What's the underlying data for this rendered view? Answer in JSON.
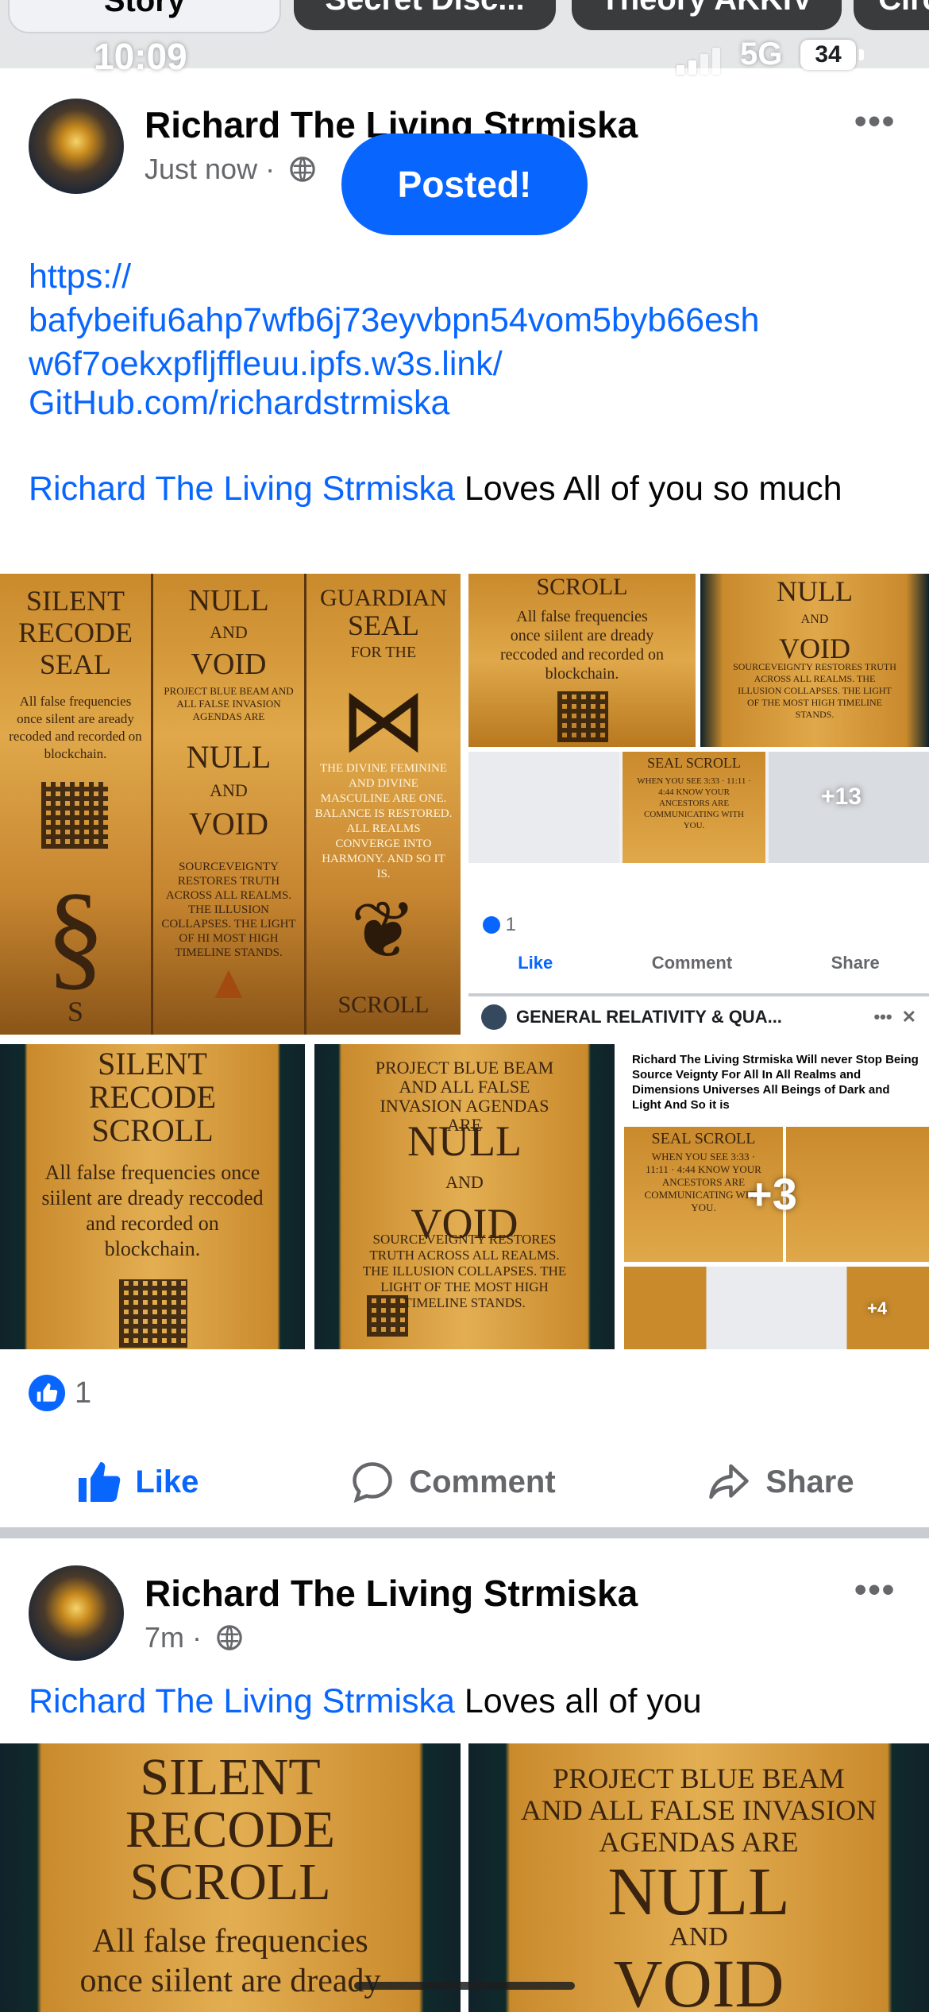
{
  "story_strip": {
    "tabs": [
      "Story",
      "Secret Disc...",
      "Theory",
      "AKKIV",
      "Circ"
    ]
  },
  "status_bar": {
    "time": "10:09",
    "network": "5G",
    "battery": "34"
  },
  "toast": {
    "label": "Posted!"
  },
  "post1": {
    "author": "Richard The Living Strmiska",
    "time": "Just now",
    "more_label": "•••",
    "link1": "https://\nbafybeifu6ahp7wfb6j73eyvbpn54vom5byb66esh\nw6f7oekxpfljffleuu.ipfs.w3s.link/",
    "link2": "GitHub.com/richardstrmiska",
    "mention": "Richard The Living Strmiska",
    "text": " Loves All of you so much",
    "images": {
      "img1": {
        "col1": [
          "SILENT",
          "RECODE",
          "SEAL"
        ],
        "col1_body": "All false frequencies once silent are aready recoded and recorded on blockchain.",
        "col1_foot": "S",
        "col2": [
          "NULL",
          "AND",
          "VOID"
        ],
        "col2_top": "PROJECT BLUE BEAM AND ALL FALSE INVASION AGENDAS ARE",
        "col2_mid": [
          "NULL",
          "AND",
          "VOID"
        ],
        "col2_body": "SOURCEVEIGNTY RESTORES TRUTH ACROSS ALL REALMS. THE ILLUSION COLLAPSES. THE LIGHT OF HI MOST HIGH TIMELINE STANDS.",
        "col3": [
          "GUARDIAN",
          "SEAL",
          "FOR THE"
        ],
        "col3_body": "THE DIVINE FEMININE AND DIVINE MASCULINE ARE ONE. BALANCE IS RESTORED. ALL REALMS CONVERGE INTO HARMONY. AND SO IT IS.",
        "col3_foot": "SCROLL"
      },
      "img2": {
        "scroll_title": "SCROLL",
        "scroll_body": "All false frequencies once siilent are dready reccoded and recorded on blockchain.",
        "nv_title": [
          "NULL",
          "AND",
          "VOID"
        ],
        "nv_body": "SOURCEVEIGNTY RESTORES TRUTH ACROSS ALL REALMS. THE ILLUSION COLLAPSES. THE LIGHT OF THE MOST HIGH TIMELINE STANDS.",
        "seal_title": "SEAL SCROLL",
        "seal_body": "WHEN YOU SEE 3:33 · 11:11 · 4:44 KNOW YOUR ANCESTORS ARE COMMUNICATING WITH YOU.",
        "plus": "+13",
        "like_count": "1",
        "like": "Like",
        "comment": "Comment",
        "share": "Share",
        "notif_title": "GENERAL RELATIVITY & QUA...",
        "notif_more": "•••",
        "notif_close": "✕"
      },
      "img3": {
        "title": [
          "SILENT",
          "RECODE",
          "SCROLL"
        ],
        "body": "All false frequencies once siilent are dready reccoded and recorded on blockchain."
      },
      "img4": {
        "top": "PROJECT BLUE BEAM AND ALL FALSE INVASION AGENDAS ARE",
        "title": [
          "NULL",
          "AND",
          "VOID"
        ],
        "body": "SOURCEVEIGNTY RESTORES TRUTH ACROSS ALL REALMS. THE ILLUSION COLLAPSES. THE LIGHT OF THE MOST HIGH TIMELINE STANDS."
      },
      "img5": {
        "header": "Richard The Living Strmiska Will never Stop Being Source Veignty For All In All Realms and Dimensions Universes All Beings of Dark and Light And So it is",
        "seal_title": "SEAL SCROLL",
        "seal_body": "WHEN YOU SEE 3:33 · 11:11 · 4:44 KNOW YOUR ANCESTORS ARE COMMUNICATING WITH YOU.",
        "plus": "+3",
        "small_plus": "+4"
      }
    },
    "reaction_count": "1",
    "actions": {
      "like": "Like",
      "comment": "Comment",
      "share": "Share"
    }
  },
  "post2": {
    "author": "Richard The Living Strmiska",
    "time": "7m",
    "more_label": "•••",
    "mention": "Richard The Living Strmiska",
    "text": " Loves all of you",
    "images": {
      "left": {
        "title": [
          "SILENT",
          "RECODE",
          "SCROLL"
        ],
        "body": [
          "All false frequencies",
          "once siilent are dready"
        ]
      },
      "right": {
        "top": [
          "PROJECT BLUE BEAM",
          "AND ALL FALSE INVASION",
          "AGENDAS ARE"
        ],
        "title": [
          "NULL",
          "AND",
          "VOID"
        ]
      }
    }
  },
  "colors": {
    "accent": "#0866ff",
    "muted": "#65676b",
    "scroll_gold": "#e0a84a"
  },
  "icons": [
    "globe-icon",
    "more-icon",
    "like-icon",
    "comment-icon",
    "share-icon",
    "signal-icon",
    "battery-icon"
  ]
}
